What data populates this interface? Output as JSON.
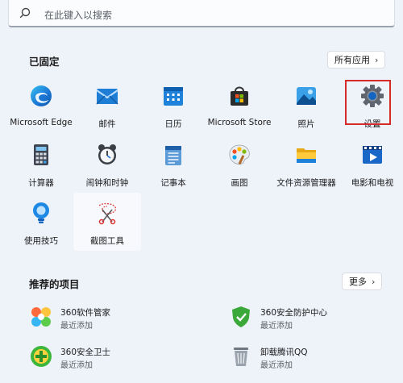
{
  "search": {
    "placeholder": "在此键入以搜索"
  },
  "pinned": {
    "title": "已固定",
    "all_apps_label": "所有应用",
    "apps": [
      {
        "label": "Microsoft Edge",
        "icon": "edge-icon"
      },
      {
        "label": "邮件",
        "icon": "mail-icon"
      },
      {
        "label": "日历",
        "icon": "calendar-icon"
      },
      {
        "label": "Microsoft Store",
        "icon": "store-icon"
      },
      {
        "label": "照片",
        "icon": "photos-icon"
      },
      {
        "label": "设置",
        "icon": "gear-icon"
      },
      {
        "label": "计算器",
        "icon": "calculator-icon"
      },
      {
        "label": "闹钟和时钟",
        "icon": "clock-icon"
      },
      {
        "label": "记事本",
        "icon": "notepad-icon"
      },
      {
        "label": "画图",
        "icon": "paint-icon"
      },
      {
        "label": "文件资源管理器",
        "icon": "folder-icon"
      },
      {
        "label": "电影和电视",
        "icon": "movies-icon"
      },
      {
        "label": "使用技巧",
        "icon": "tips-icon"
      },
      {
        "label": "截图工具",
        "icon": "snipping-icon"
      }
    ]
  },
  "recommended": {
    "title": "推荐的项目",
    "more_label": "更多",
    "items": [
      {
        "name": "360软件管家",
        "sub": "最近添加",
        "icon": "360-software-icon"
      },
      {
        "name": "360安全防护中心",
        "sub": "最近添加",
        "icon": "360-shield-icon"
      },
      {
        "name": "360安全卫士",
        "sub": "最近添加",
        "icon": "360-guard-icon"
      },
      {
        "name": "卸载腾讯QQ",
        "sub": "最近添加",
        "icon": "recycle-bin-icon"
      }
    ]
  }
}
